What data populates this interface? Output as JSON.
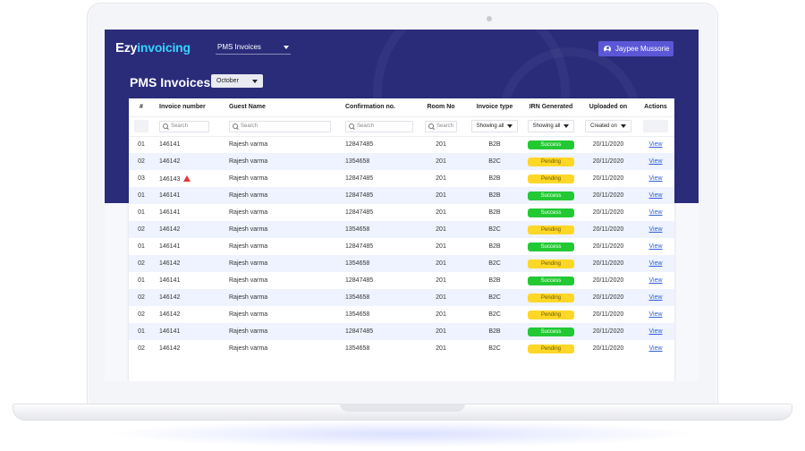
{
  "header": {
    "logo_e": "E",
    "logo_part1": "zy",
    "logo_part2": "invoicing",
    "module": "PMS Invoices",
    "user": "Jaypee Mussorie"
  },
  "page": {
    "title": "PMS Invoices",
    "month": "October"
  },
  "colors": {
    "hero": "#2a2c7a",
    "accent": "#5b57d6",
    "success": "#22c933",
    "pending": "#ffd726",
    "link": "#2f5fd8"
  },
  "table": {
    "headers": [
      "#",
      "Invoice number",
      "Guest Name",
      "Confirmation no.",
      "Room No",
      "Invoice type",
      "IRN Generated",
      "Uploaded on",
      "Actions"
    ],
    "filters": {
      "search_placeholder": "Search",
      "invoice_type": "Showing all",
      "irn": "Showing all",
      "uploaded": "Created on"
    },
    "rows": [
      {
        "num": "01",
        "invoice": "146141",
        "guest": "Rajesh varma",
        "confirmation": "12847485",
        "room": "201",
        "type": "B2B",
        "irn": "Success",
        "uploaded": "20/11/2020",
        "action": "View"
      },
      {
        "num": "02",
        "invoice": "146142",
        "guest": "Rajesh varma",
        "confirmation": "1354658",
        "room": "201",
        "type": "B2C",
        "irn": "Pending",
        "uploaded": "20/11/2020",
        "action": "View"
      },
      {
        "num": "03",
        "invoice": "146143",
        "guest": "Rajesh varma",
        "confirmation": "12847485",
        "room": "201",
        "type": "B2B",
        "irn": "Pending",
        "uploaded": "20/11/2020",
        "action": "View",
        "warning": true
      },
      {
        "num": "01",
        "invoice": "146141",
        "guest": "Rajesh varma",
        "confirmation": "12847485",
        "room": "201",
        "type": "B2B",
        "irn": "Success",
        "uploaded": "20/11/2020",
        "action": "View"
      },
      {
        "num": "01",
        "invoice": "146141",
        "guest": "Rajesh varma",
        "confirmation": "12847485",
        "room": "201",
        "type": "B2B",
        "irn": "Success",
        "uploaded": "20/11/2020",
        "action": "View"
      },
      {
        "num": "02",
        "invoice": "146142",
        "guest": "Rajesh varma",
        "confirmation": "1354658",
        "room": "201",
        "type": "B2C",
        "irn": "Pending",
        "uploaded": "20/11/2020",
        "action": "View"
      },
      {
        "num": "01",
        "invoice": "146141",
        "guest": "Rajesh varma",
        "confirmation": "12847485",
        "room": "201",
        "type": "B2B",
        "irn": "Success",
        "uploaded": "20/11/2020",
        "action": "View"
      },
      {
        "num": "02",
        "invoice": "146142",
        "guest": "Rajesh varma",
        "confirmation": "1354658",
        "room": "201",
        "type": "B2C",
        "irn": "Pending",
        "uploaded": "20/11/2020",
        "action": "View"
      },
      {
        "num": "01",
        "invoice": "146141",
        "guest": "Rajesh varma",
        "confirmation": "12847485",
        "room": "201",
        "type": "B2B",
        "irn": "Success",
        "uploaded": "20/11/2020",
        "action": "View"
      },
      {
        "num": "02",
        "invoice": "146142",
        "guest": "Rajesh varma",
        "confirmation": "1354658",
        "room": "201",
        "type": "B2C",
        "irn": "Pending",
        "uploaded": "20/11/2020",
        "action": "View"
      },
      {
        "num": "02",
        "invoice": "146142",
        "guest": "Rajesh varma",
        "confirmation": "1354658",
        "room": "201",
        "type": "B2C",
        "irn": "Pending",
        "uploaded": "20/11/2020",
        "action": "View"
      },
      {
        "num": "01",
        "invoice": "146141",
        "guest": "Rajesh varma",
        "confirmation": "12847485",
        "room": "201",
        "type": "B2B",
        "irn": "Success",
        "uploaded": "20/11/2020",
        "action": "View"
      },
      {
        "num": "02",
        "invoice": "146142",
        "guest": "Rajesh varma",
        "confirmation": "1354658",
        "room": "201",
        "type": "B2C",
        "irn": "Pending",
        "uploaded": "20/11/2020",
        "action": "View"
      }
    ]
  }
}
